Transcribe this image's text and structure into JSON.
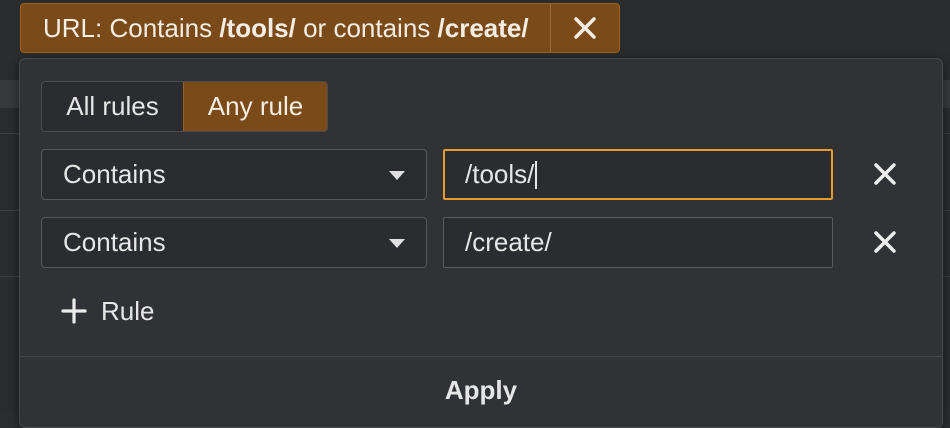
{
  "filter_chip": {
    "prefix": "URL: Contains ",
    "value1": "/tools/",
    "middle": " or contains ",
    "value2": "/create/"
  },
  "match_mode": {
    "options": [
      "All rules",
      "Any rule"
    ],
    "selected": "Any rule"
  },
  "rules": [
    {
      "operator": "Contains",
      "value": "/tools/",
      "focused": true
    },
    {
      "operator": "Contains",
      "value": "/create/",
      "focused": false
    }
  ],
  "add_rule_label": "Rule",
  "apply_label": "Apply",
  "colors": {
    "accent": "#7a4a18",
    "focus_border": "#e89a2c",
    "panel_bg": "#313235"
  },
  "icons": {
    "chip_close": "close-icon",
    "rule_remove": "close-icon",
    "add": "plus-icon",
    "dropdown": "chevron-down-icon"
  }
}
